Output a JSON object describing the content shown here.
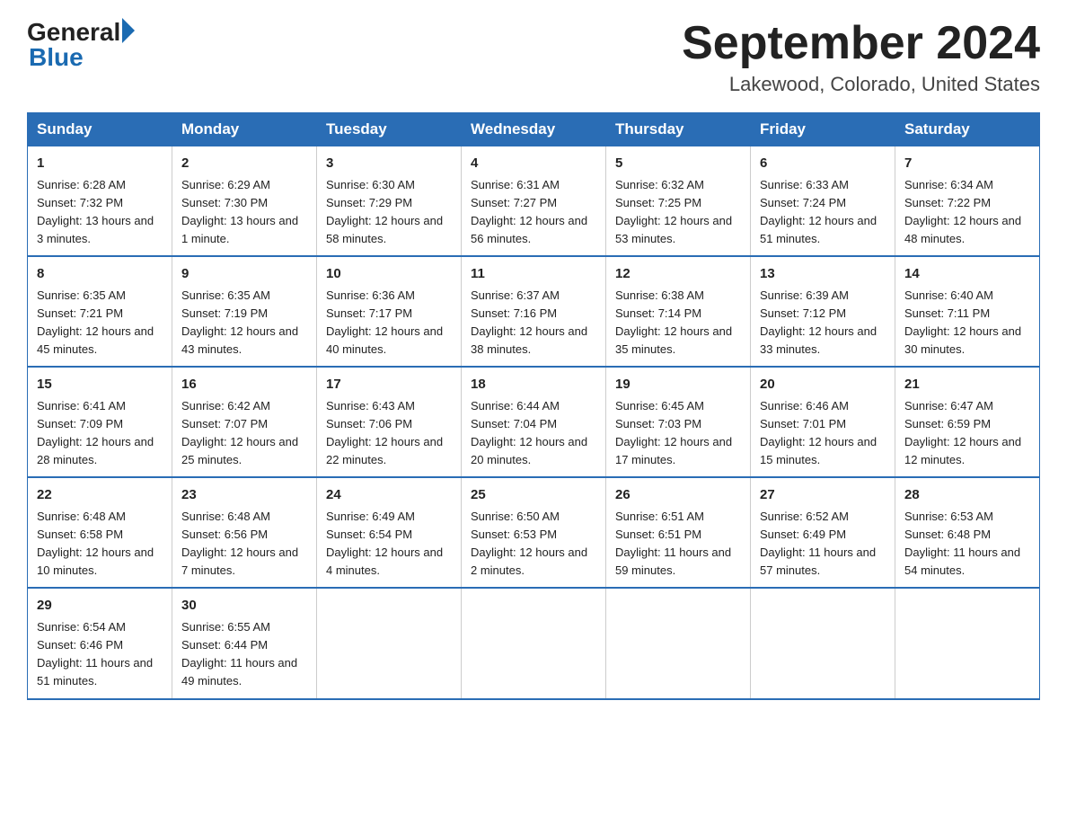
{
  "header": {
    "logo_general": "General",
    "logo_blue": "Blue",
    "month_title": "September 2024",
    "location": "Lakewood, Colorado, United States"
  },
  "days_of_week": [
    "Sunday",
    "Monday",
    "Tuesday",
    "Wednesday",
    "Thursday",
    "Friday",
    "Saturday"
  ],
  "weeks": [
    [
      {
        "day": "1",
        "sunrise": "6:28 AM",
        "sunset": "7:32 PM",
        "daylight": "13 hours and 3 minutes."
      },
      {
        "day": "2",
        "sunrise": "6:29 AM",
        "sunset": "7:30 PM",
        "daylight": "13 hours and 1 minute."
      },
      {
        "day": "3",
        "sunrise": "6:30 AM",
        "sunset": "7:29 PM",
        "daylight": "12 hours and 58 minutes."
      },
      {
        "day": "4",
        "sunrise": "6:31 AM",
        "sunset": "7:27 PM",
        "daylight": "12 hours and 56 minutes."
      },
      {
        "day": "5",
        "sunrise": "6:32 AM",
        "sunset": "7:25 PM",
        "daylight": "12 hours and 53 minutes."
      },
      {
        "day": "6",
        "sunrise": "6:33 AM",
        "sunset": "7:24 PM",
        "daylight": "12 hours and 51 minutes."
      },
      {
        "day": "7",
        "sunrise": "6:34 AM",
        "sunset": "7:22 PM",
        "daylight": "12 hours and 48 minutes."
      }
    ],
    [
      {
        "day": "8",
        "sunrise": "6:35 AM",
        "sunset": "7:21 PM",
        "daylight": "12 hours and 45 minutes."
      },
      {
        "day": "9",
        "sunrise": "6:35 AM",
        "sunset": "7:19 PM",
        "daylight": "12 hours and 43 minutes."
      },
      {
        "day": "10",
        "sunrise": "6:36 AM",
        "sunset": "7:17 PM",
        "daylight": "12 hours and 40 minutes."
      },
      {
        "day": "11",
        "sunrise": "6:37 AM",
        "sunset": "7:16 PM",
        "daylight": "12 hours and 38 minutes."
      },
      {
        "day": "12",
        "sunrise": "6:38 AM",
        "sunset": "7:14 PM",
        "daylight": "12 hours and 35 minutes."
      },
      {
        "day": "13",
        "sunrise": "6:39 AM",
        "sunset": "7:12 PM",
        "daylight": "12 hours and 33 minutes."
      },
      {
        "day": "14",
        "sunrise": "6:40 AM",
        "sunset": "7:11 PM",
        "daylight": "12 hours and 30 minutes."
      }
    ],
    [
      {
        "day": "15",
        "sunrise": "6:41 AM",
        "sunset": "7:09 PM",
        "daylight": "12 hours and 28 minutes."
      },
      {
        "day": "16",
        "sunrise": "6:42 AM",
        "sunset": "7:07 PM",
        "daylight": "12 hours and 25 minutes."
      },
      {
        "day": "17",
        "sunrise": "6:43 AM",
        "sunset": "7:06 PM",
        "daylight": "12 hours and 22 minutes."
      },
      {
        "day": "18",
        "sunrise": "6:44 AM",
        "sunset": "7:04 PM",
        "daylight": "12 hours and 20 minutes."
      },
      {
        "day": "19",
        "sunrise": "6:45 AM",
        "sunset": "7:03 PM",
        "daylight": "12 hours and 17 minutes."
      },
      {
        "day": "20",
        "sunrise": "6:46 AM",
        "sunset": "7:01 PM",
        "daylight": "12 hours and 15 minutes."
      },
      {
        "day": "21",
        "sunrise": "6:47 AM",
        "sunset": "6:59 PM",
        "daylight": "12 hours and 12 minutes."
      }
    ],
    [
      {
        "day": "22",
        "sunrise": "6:48 AM",
        "sunset": "6:58 PM",
        "daylight": "12 hours and 10 minutes."
      },
      {
        "day": "23",
        "sunrise": "6:48 AM",
        "sunset": "6:56 PM",
        "daylight": "12 hours and 7 minutes."
      },
      {
        "day": "24",
        "sunrise": "6:49 AM",
        "sunset": "6:54 PM",
        "daylight": "12 hours and 4 minutes."
      },
      {
        "day": "25",
        "sunrise": "6:50 AM",
        "sunset": "6:53 PM",
        "daylight": "12 hours and 2 minutes."
      },
      {
        "day": "26",
        "sunrise": "6:51 AM",
        "sunset": "6:51 PM",
        "daylight": "11 hours and 59 minutes."
      },
      {
        "day": "27",
        "sunrise": "6:52 AM",
        "sunset": "6:49 PM",
        "daylight": "11 hours and 57 minutes."
      },
      {
        "day": "28",
        "sunrise": "6:53 AM",
        "sunset": "6:48 PM",
        "daylight": "11 hours and 54 minutes."
      }
    ],
    [
      {
        "day": "29",
        "sunrise": "6:54 AM",
        "sunset": "6:46 PM",
        "daylight": "11 hours and 51 minutes."
      },
      {
        "day": "30",
        "sunrise": "6:55 AM",
        "sunset": "6:44 PM",
        "daylight": "11 hours and 49 minutes."
      },
      null,
      null,
      null,
      null,
      null
    ]
  ]
}
